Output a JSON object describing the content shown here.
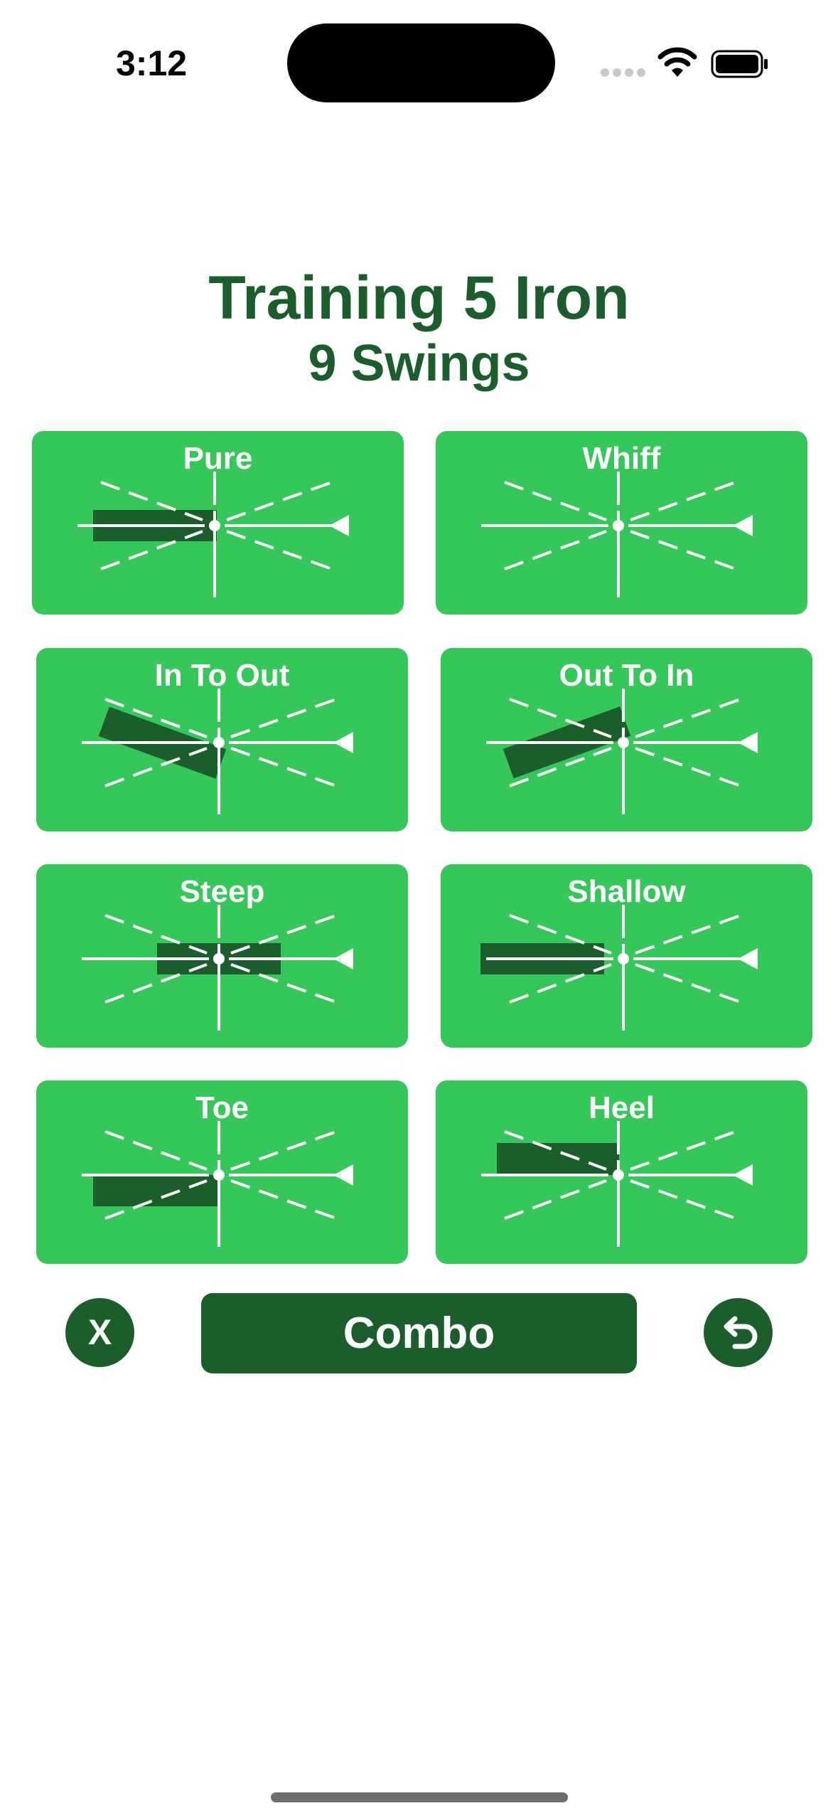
{
  "status_bar": {
    "time": "3:12",
    "wifi_icon": "wifi-icon",
    "battery_icon": "battery-icon",
    "signal_icon": "cellular-signal-icon"
  },
  "header": {
    "title": "Training 5 Iron",
    "subtitle": "9 Swings"
  },
  "cards": [
    {
      "label": "Pure",
      "marker": "pure"
    },
    {
      "label": "Whiff",
      "marker": "none"
    },
    {
      "label": "In To Out",
      "marker": "in-to-out"
    },
    {
      "label": "Out To In",
      "marker": "out-to-in"
    },
    {
      "label": "Steep",
      "marker": "steep"
    },
    {
      "label": "Shallow",
      "marker": "shallow"
    },
    {
      "label": "Toe",
      "marker": "toe"
    },
    {
      "label": "Heel",
      "marker": "heel"
    }
  ],
  "actions": {
    "close_label": "X",
    "combo_label": "Combo",
    "undo_icon": "undo-icon"
  },
  "colors": {
    "card_green": "#35c75a",
    "dark_green": "#1b5e2b",
    "line_white": "#ffffff"
  }
}
